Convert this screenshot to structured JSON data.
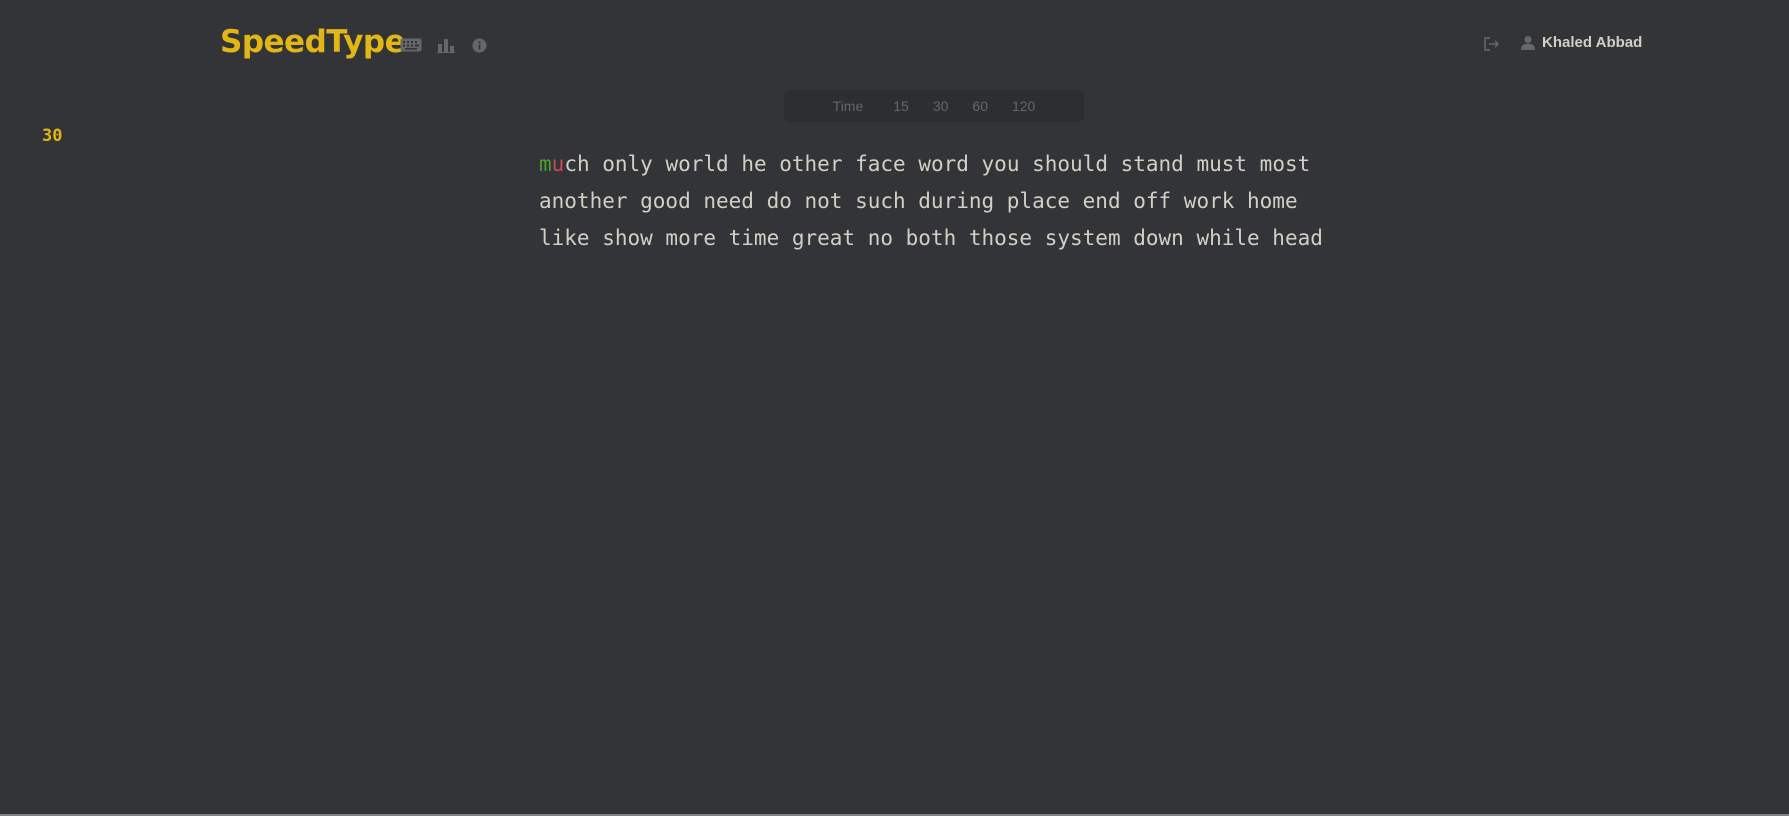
{
  "header": {
    "logo": "SpeedType",
    "icons": [
      "keyboard-icon",
      "leaderboard-icon",
      "info-icon"
    ],
    "user_name": "Khaled Abbad"
  },
  "mode_bar": {
    "label": "Time",
    "options": [
      "15",
      "30",
      "60",
      "120"
    ]
  },
  "timer": "30",
  "typing": {
    "first_word_correct": "m",
    "first_word_incorrect": "u",
    "first_word_rest": "ch only world he other face word you should stand must most",
    "line2": "another good need do not such during place end off work home",
    "line3": "like show more time great no both those system down while head"
  },
  "colors": {
    "background": "#323437",
    "accent": "#e2b714",
    "text": "#d1d0c5",
    "muted": "#646669",
    "correct": "#4aa02c",
    "incorrect": "#ca4754"
  }
}
